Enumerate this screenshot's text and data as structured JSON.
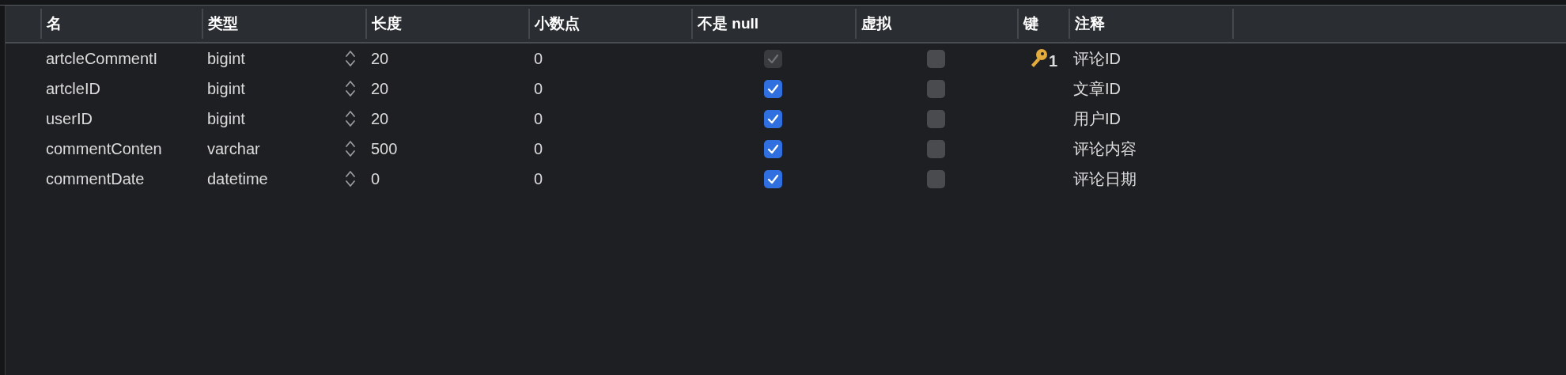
{
  "table": {
    "columns": [
      "名",
      "类型",
      "长度",
      "小数点",
      "不是 null",
      "虚拟",
      "键",
      "注释"
    ],
    "rows": [
      {
        "name": "artcleCommentI",
        "type": "bigint",
        "length": "20",
        "decimals": "0",
        "not_null": {
          "checked": true,
          "disabled": true
        },
        "virtual": {
          "checked": false
        },
        "key": "1",
        "comment": "评论ID"
      },
      {
        "name": "artcleID",
        "type": "bigint",
        "length": "20",
        "decimals": "0",
        "not_null": {
          "checked": true,
          "disabled": false
        },
        "virtual": {
          "checked": false
        },
        "comment": "文章ID"
      },
      {
        "name": "userID",
        "type": "bigint",
        "length": "20",
        "decimals": "0",
        "not_null": {
          "checked": true,
          "disabled": false
        },
        "virtual": {
          "checked": false
        },
        "comment": "用户ID"
      },
      {
        "name": "commentConten",
        "type": "varchar",
        "length": "500",
        "decimals": "0",
        "not_null": {
          "checked": true,
          "disabled": false
        },
        "virtual": {
          "checked": false
        },
        "comment": "评论内容"
      },
      {
        "name": "commentDate",
        "type": "datetime",
        "length": "0",
        "decimals": "0",
        "not_null": {
          "checked": true,
          "disabled": false
        },
        "virtual": {
          "checked": false
        },
        "comment": "评论日期"
      }
    ]
  }
}
